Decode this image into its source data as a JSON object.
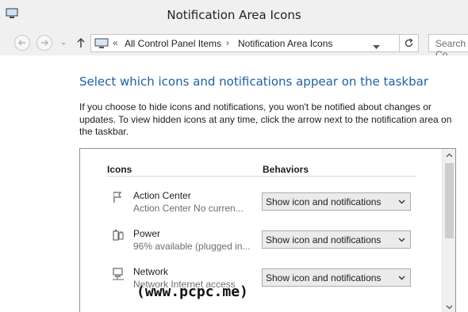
{
  "window": {
    "title": "Notification Area Icons"
  },
  "address_bar": {
    "separator": "«",
    "crumbs": [
      "All Control Panel Items",
      "Notification Area Icons"
    ],
    "crumb_separator": "›",
    "search_placeholder": "Search Co"
  },
  "page": {
    "heading": "Select which icons and notifications appear on the taskbar",
    "description": "If you choose to hide icons and notifications, you won't be notified about changes or updates. To view hidden icons at any time, click the arrow next to the notification area on the taskbar.",
    "columns": {
      "icons": "Icons",
      "behaviors": "Behaviors"
    },
    "rows": [
      {
        "name": "Action Center",
        "sub": "Action Center  No curren...",
        "behavior": "Show icon and notifications",
        "icon": "flag-icon"
      },
      {
        "name": "Power",
        "sub": "96% available (plugged in...",
        "behavior": "Show icon and notifications",
        "icon": "battery-icon"
      },
      {
        "name": "Network",
        "sub": "Network  Internet access",
        "behavior": "Show icon and notifications",
        "icon": "network-icon"
      }
    ]
  },
  "watermark": "(www.pcpc.me)",
  "colors": {
    "heading": "#1e5fa8",
    "chrome": "#f0f0f0",
    "select_bg": "#ebebeb"
  }
}
